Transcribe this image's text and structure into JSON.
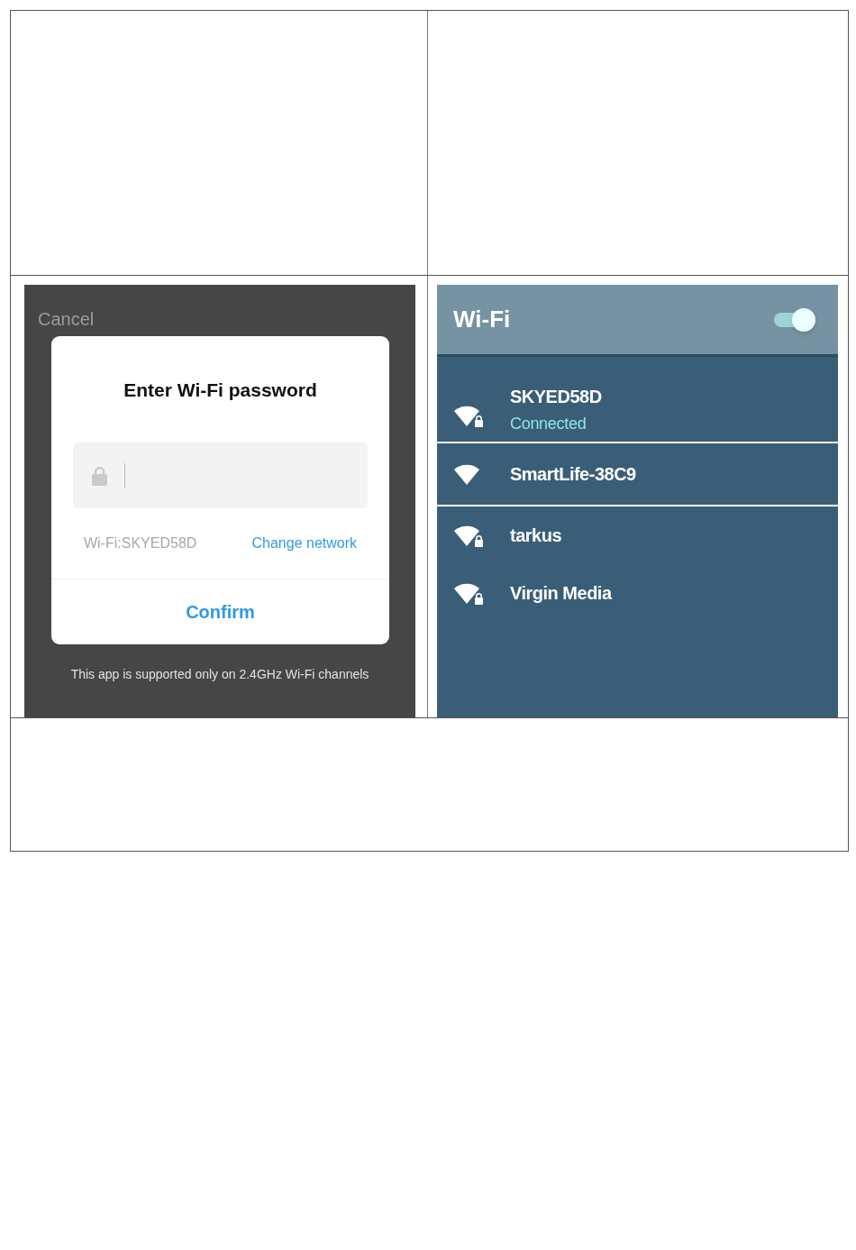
{
  "password_screen": {
    "cancel_button": "Cancel",
    "dialog": {
      "title": "Enter Wi-Fi password",
      "network_label": "Wi-Fi:SKYED58D",
      "change_network_link": "Change network",
      "confirm_button": "Confirm"
    },
    "note": "This app is supported only on 2.4GHz Wi-Fi channels"
  },
  "wifi_screen": {
    "title": "Wi-Fi",
    "toggle": {
      "on": true
    },
    "networks": [
      {
        "name": "SKYED58D",
        "status": "Connected",
        "locked": true,
        "selected": false
      },
      {
        "name": "SmartLife-38C9",
        "locked": false,
        "selected": true
      },
      {
        "name": "tarkus",
        "locked": true,
        "selected": false
      },
      {
        "name": "Virgin Media",
        "locked": true,
        "selected": false
      }
    ]
  }
}
